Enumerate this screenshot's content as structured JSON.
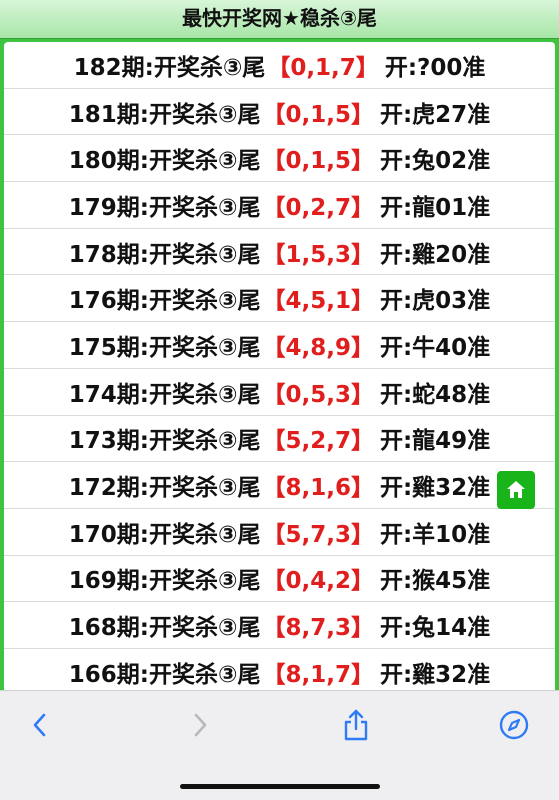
{
  "header": {
    "title": "最快开奖网★稳杀③尾"
  },
  "rows": [
    {
      "prefix": "182期:开奖杀③尾",
      "nums": "【0,1,7】",
      "result": "开:?00准"
    },
    {
      "prefix": "181期:开奖杀③尾",
      "nums": "【0,1,5】",
      "result": "开:虎27准"
    },
    {
      "prefix": "180期:开奖杀③尾",
      "nums": "【0,1,5】",
      "result": "开:兔02准"
    },
    {
      "prefix": "179期:开奖杀③尾",
      "nums": "【0,2,7】",
      "result": "开:龍01准"
    },
    {
      "prefix": "178期:开奖杀③尾",
      "nums": "【1,5,3】",
      "result": "开:雞20准"
    },
    {
      "prefix": "176期:开奖杀③尾",
      "nums": "【4,5,1】",
      "result": "开:虎03准"
    },
    {
      "prefix": "175期:开奖杀③尾",
      "nums": "【4,8,9】",
      "result": "开:牛40准"
    },
    {
      "prefix": "174期:开奖杀③尾",
      "nums": "【0,5,3】",
      "result": "开:蛇48准"
    },
    {
      "prefix": "173期:开奖杀③尾",
      "nums": "【5,2,7】",
      "result": "开:龍49准"
    },
    {
      "prefix": "172期:开奖杀③尾",
      "nums": "【8,1,6】",
      "result": "开:雞32准"
    },
    {
      "prefix": "170期:开奖杀③尾",
      "nums": "【5,7,3】",
      "result": "开:羊10准"
    },
    {
      "prefix": "169期:开奖杀③尾",
      "nums": "【0,4,2】",
      "result": "开:猴45准"
    },
    {
      "prefix": "168期:开奖杀③尾",
      "nums": "【8,7,3】",
      "result": "开:兔14准"
    },
    {
      "prefix": "166期:开奖杀③尾",
      "nums": "【8,1,7】",
      "result": "开:雞32准"
    }
  ],
  "floating": {
    "icon": "home-icon"
  },
  "toolbar": {
    "back_icon": "chevron-left-icon",
    "forward_icon": "chevron-right-icon",
    "share_icon": "share-icon",
    "safari_icon": "compass-icon"
  },
  "colors": {
    "page_border": "#3fc43f",
    "number_red": "#e01e1e",
    "toolbar_blue": "#2f7bf6",
    "home_button": "#19b419"
  }
}
